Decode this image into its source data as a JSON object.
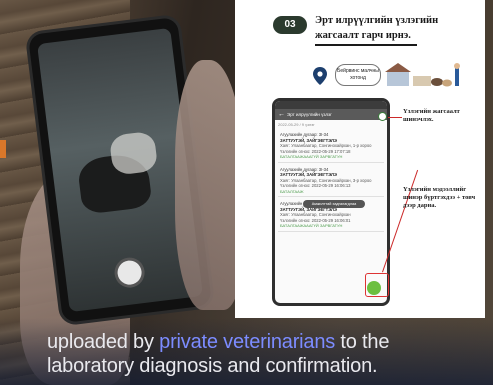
{
  "slide": {
    "step_number": "03",
    "title": "Эрт илрүүлгийн үзлэгийн жагсаалт гарч ирнэ.",
    "bubble_text": "Бейрвинс малчны хотонд",
    "app_bar_title": "Эрт илрүүлгийн үзлэг",
    "date_row": "2022-05-29 / 9 үзлэг",
    "cards": [
      {
        "l1": "Агуулахийн дугаар: 3I-34",
        "l2": "ЗАТТУУГЭЙ, ЗАЙГЭЕГТЭЛЭ",
        "l3": "Хаяг: Улаанбаатар, Сонгинохайрхан, 1-р хороо",
        "l3b": "Үзлэгийн огноо: 2022-05-29 17:07:18",
        "l4": "БАТАЛГААЖАААГҮЙ ЗАРВГАТУН"
      },
      {
        "l1": "Агуулахийн дугаар: 3I-34",
        "l2": "ЗАТТУУГЭЙ, ЗАЙГЭЕГТЭЛЭ",
        "l3": "Хаяг: Улаанбаатар, Сонгинохайрхан, 3-р хороо",
        "l3b": "Үзлэгийн огноо: 2022-05-29 16:06:13",
        "l4": "БАТАЛГААЖ"
      },
      {
        "l1": "Агуулахийн дугаар: 3I-34",
        "l2": "ЗАТТУУГЭЙ, ЗАЙГЭЕГТЭЛЭ",
        "l3": "Хаяг: Улаанбаатар, Сонгинохайрхан",
        "l3b": "Үзлэгийн огноо: 2022-05-29 16:06:01",
        "l4": "БАТАЛГААЖАААГҮЙ ЗАРВГАТУН"
      }
    ],
    "toast": "Амжилттай хадгалагдлаа",
    "callout_top": "Үзлэгийн жагсаалт шинэчлэх.",
    "callout_bottom": "Үзлэгийн мэдээллийг шинэр бүртгэхдээ + товч дээр дарна."
  },
  "caption": {
    "part1": "uploaded by ",
    "highlight": "private veterinarians",
    "part2": " to the",
    "line2": "laboratory diagnosis and confirmation."
  },
  "colors": {
    "step_pill": "#2b3a2e",
    "highlight": "#7c8cff",
    "callout_line": "#cc2a2a",
    "fab": "#6cbf3f"
  }
}
